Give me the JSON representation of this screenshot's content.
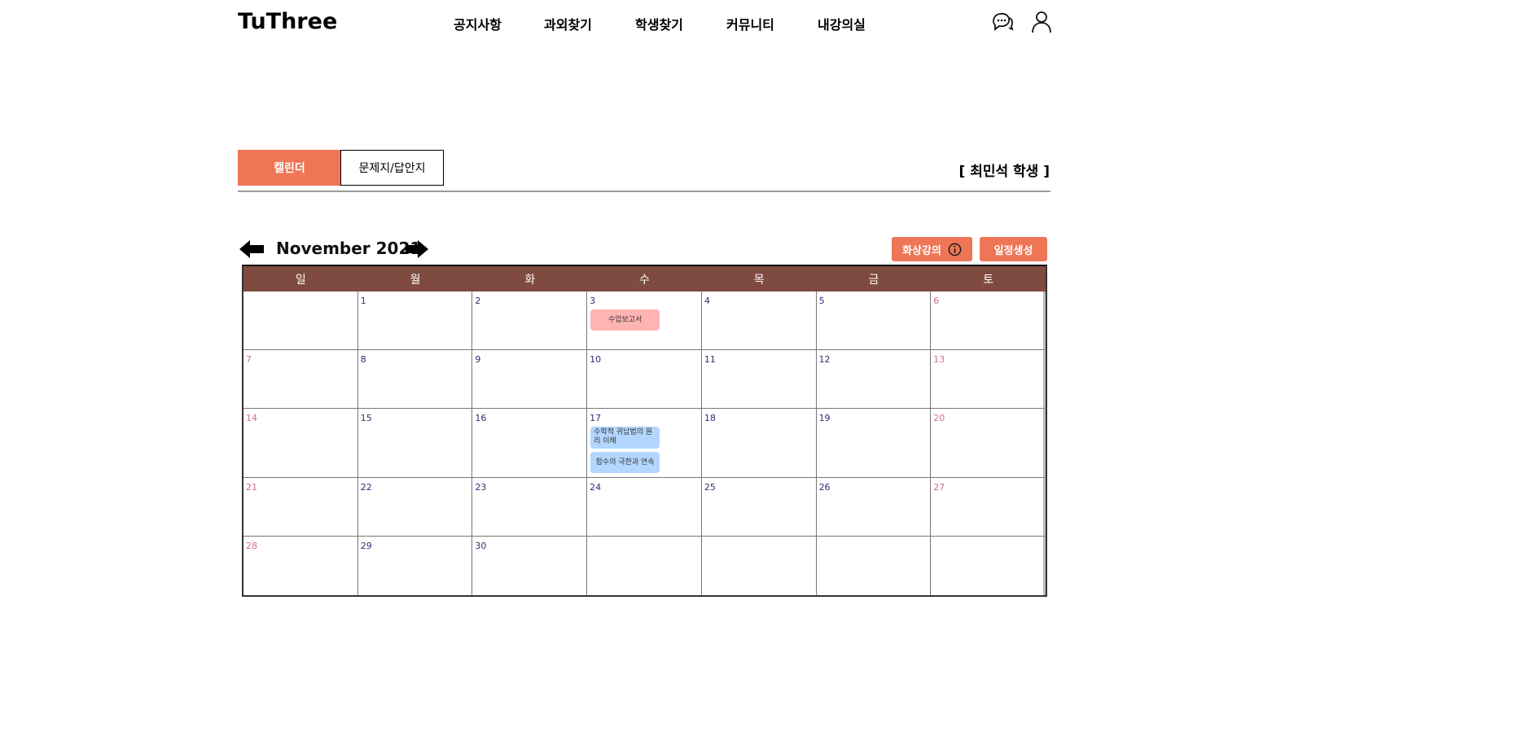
{
  "header": {
    "logo": "TuThree",
    "nav": [
      "공지사항",
      "과외찾기",
      "학생찾기",
      "커뮤니티",
      "내강의실"
    ],
    "icons": [
      "chat-icon",
      "user-icon"
    ]
  },
  "tabs": {
    "active": "캘린더",
    "inactive": "문제지/답안지"
  },
  "student_label": "[ 최민석 학생 ]",
  "calendar": {
    "month_label": "November 2021",
    "buttons": {
      "video": "화상강의",
      "schedule": "일정생성"
    },
    "weekdays": [
      "일",
      "월",
      "화",
      "수",
      "목",
      "금",
      "토"
    ],
    "weeks": [
      [
        "",
        "1",
        "2",
        "3",
        "4",
        "5",
        "6"
      ],
      [
        "7",
        "8",
        "9",
        "10",
        "11",
        "12",
        "13"
      ],
      [
        "14",
        "15",
        "16",
        "17",
        "18",
        "19",
        "20"
      ],
      [
        "21",
        "22",
        "23",
        "24",
        "25",
        "26",
        "27"
      ],
      [
        "28",
        "29",
        "30",
        "",
        "",
        "",
        ""
      ]
    ],
    "events": {
      "nov3": "수업보고서",
      "nov17_a": "수학적 귀납법의 원리 이해",
      "nov17_b": "함수의 극한과 연속"
    },
    "colors": {
      "accent": "#ee7657",
      "header_bg": "#7f4a3f",
      "weekend_day": "#d06f86",
      "weekday_day": "#2b2f73",
      "event_report": "#ffb4b4",
      "event_lesson": "#b3d6ff"
    }
  }
}
